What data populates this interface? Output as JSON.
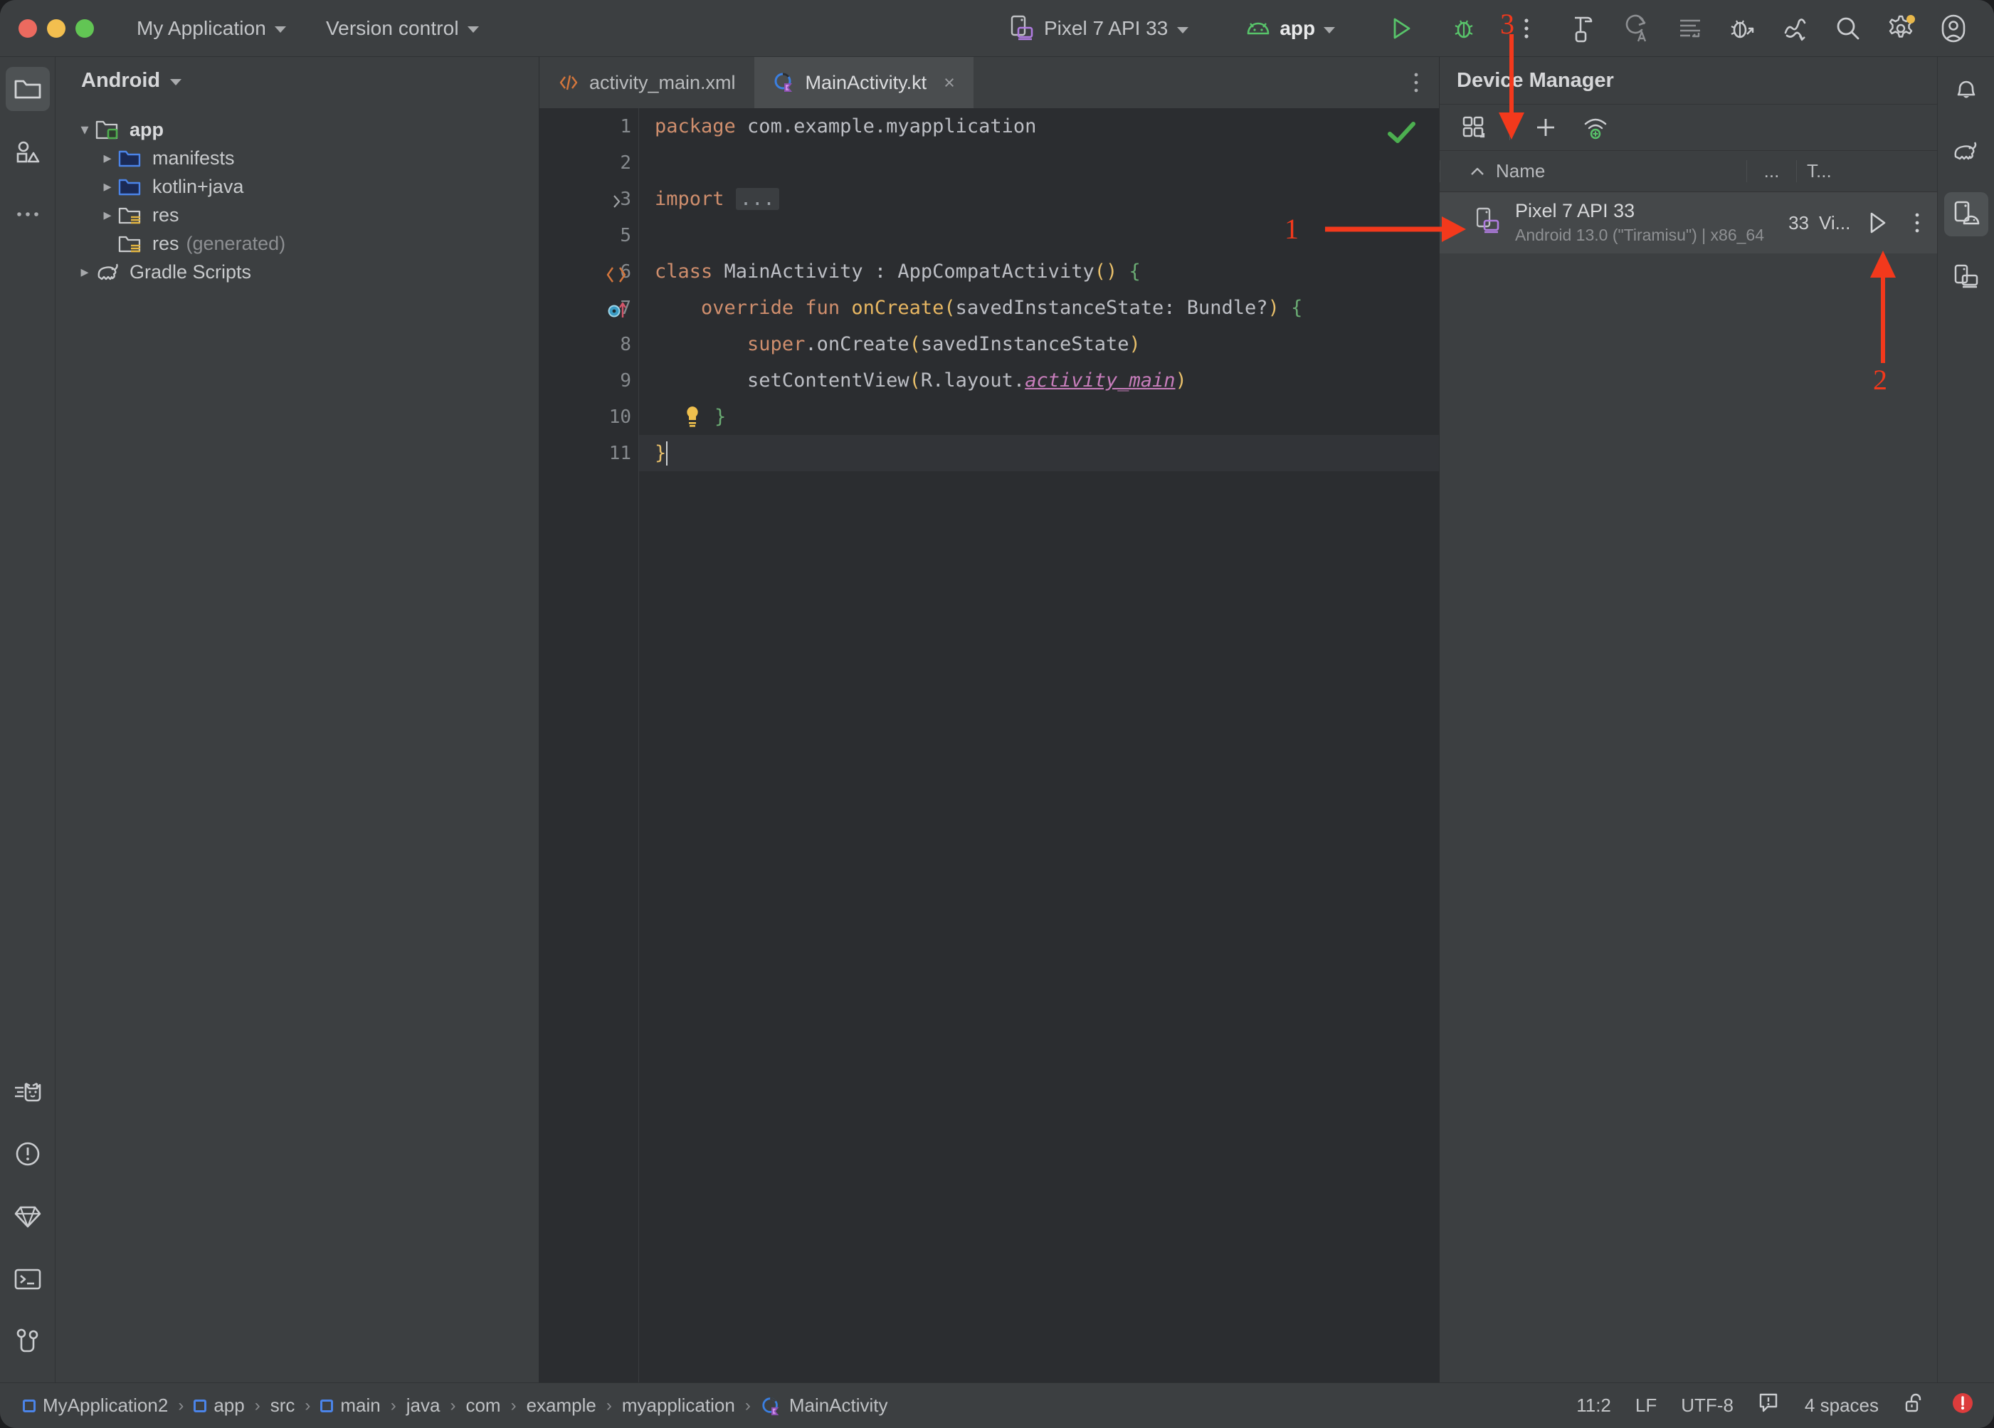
{
  "window": {
    "traffic": [
      "close",
      "minimize",
      "zoom"
    ]
  },
  "toolbar": {
    "project_name": "My Application",
    "vcs_label": "Version control",
    "device_selector": "Pixel 7 API 33",
    "run_config": "app",
    "icons": [
      "more-vertical-icon",
      "build-hammer-icon",
      "redo-a-icon",
      "code-format-icon",
      "debug-attach-icon",
      "profiler-icon",
      "search-icon",
      "settings-gear-icon",
      "account-icon"
    ]
  },
  "left_rail": {
    "items": [
      {
        "name": "project-tool-window",
        "icon": "folder-icon",
        "selected": true
      },
      {
        "name": "resource-manager",
        "icon": "shapes-icon",
        "selected": false
      },
      {
        "name": "more-tool-windows",
        "icon": "ellipsis-icon",
        "selected": false
      },
      {
        "name": "logcat",
        "icon": "cat-icon",
        "selected": false
      },
      {
        "name": "problems",
        "icon": "warning-circle-icon",
        "selected": false
      },
      {
        "name": "build",
        "icon": "diamond-icon",
        "selected": false
      },
      {
        "name": "terminal",
        "icon": "terminal-icon",
        "selected": false
      },
      {
        "name": "version-control",
        "icon": "git-branch-icon",
        "selected": false
      }
    ]
  },
  "project": {
    "title": "Android",
    "tree": [
      {
        "label": "app",
        "icon": "module-folder-icon",
        "expanded": true,
        "indent": 0,
        "bold": true,
        "dim": ""
      },
      {
        "label": "manifests",
        "icon": "blue-folder-icon",
        "expanded": false,
        "indent": 1,
        "bold": false,
        "dim": ""
      },
      {
        "label": "kotlin+java",
        "icon": "blue-folder-icon",
        "expanded": false,
        "indent": 1,
        "bold": false,
        "dim": ""
      },
      {
        "label": "res",
        "icon": "res-folder-icon",
        "expanded": false,
        "indent": 1,
        "bold": false,
        "dim": ""
      },
      {
        "label": "res",
        "icon": "res-folder-icon",
        "expanded": null,
        "indent": 1,
        "bold": false,
        "dim": "(generated)"
      },
      {
        "label": "Gradle Scripts",
        "icon": "gradle-elephant-icon",
        "expanded": false,
        "indent": 0,
        "bold": false,
        "dim": ""
      }
    ]
  },
  "editor": {
    "tabs": [
      {
        "label": "activity_main.xml",
        "icon": "xml-icon",
        "active": false,
        "closable": false
      },
      {
        "label": "MainActivity.kt",
        "icon": "kotlin-class-icon",
        "active": true,
        "closable": true,
        "close_label": "×"
      }
    ],
    "line_numbers": [
      "1",
      "2",
      "3",
      "5",
      "6",
      "7",
      "8",
      "9",
      "10",
      "11"
    ],
    "current_line": "11",
    "inspection_status": "ok-checkmark",
    "lines": [
      {
        "num": "1",
        "gutter": "",
        "text": "package com.example.myapplication"
      },
      {
        "num": "2",
        "gutter": "",
        "text": ""
      },
      {
        "num": "3",
        "gutter": "fold-arrow",
        "text": "import ..."
      },
      {
        "num": "5",
        "gutter": "",
        "text": ""
      },
      {
        "num": "6",
        "gutter": "xml-marker",
        "text": "class MainActivity : AppCompatActivity() {"
      },
      {
        "num": "7",
        "gutter": "override-marker",
        "text": "    override fun onCreate(savedInstanceState: Bundle?) {"
      },
      {
        "num": "8",
        "gutter": "",
        "text": "        super.onCreate(savedInstanceState)"
      },
      {
        "num": "9",
        "gutter": "",
        "text": "        setContentView(R.layout.activity_main)"
      },
      {
        "num": "10",
        "gutter": "",
        "text": "    }",
        "hint": "lightbulb-icon"
      },
      {
        "num": "11",
        "gutter": "",
        "text": "}"
      }
    ]
  },
  "device_manager": {
    "title": "Device Manager",
    "toolbar_icons": [
      "device-grid-icon",
      "add-device-icon",
      "pair-wifi-icon"
    ],
    "columns": [
      "Name",
      "...",
      "T...",
      ""
    ],
    "sort_indicator": "ascending",
    "rows": [
      {
        "name": "Pixel 7 API 33",
        "sub": "Android 13.0 (\"Tiramisu\")  |  x86_64",
        "api": "33",
        "type": "Vi...",
        "actions": [
          "launch-play-icon",
          "overflow-menu-icon"
        ],
        "selected": true
      }
    ]
  },
  "right_rail": {
    "items": [
      {
        "name": "notifications",
        "icon": "bell-icon",
        "selected": false
      },
      {
        "name": "gradle",
        "icon": "gradle-elephant-icon",
        "selected": false
      },
      {
        "name": "device-manager",
        "icon": "device-manager-icon",
        "selected": true
      },
      {
        "name": "running-devices",
        "icon": "running-devices-icon",
        "selected": false
      }
    ]
  },
  "status_bar": {
    "breadcrumbs": [
      {
        "label": "MyApplication2",
        "icon": "module-icon"
      },
      {
        "label": "app",
        "icon": "module-icon"
      },
      {
        "label": "src",
        "icon": ""
      },
      {
        "label": "main",
        "icon": "module-icon"
      },
      {
        "label": "java",
        "icon": ""
      },
      {
        "label": "com",
        "icon": ""
      },
      {
        "label": "example",
        "icon": ""
      },
      {
        "label": "myapplication",
        "icon": ""
      },
      {
        "label": "MainActivity",
        "icon": "kotlin-class-icon"
      }
    ],
    "separator": "›",
    "caret_position": "11:2",
    "line_separator": "LF",
    "encoding": "UTF-8",
    "indent": "4 spaces",
    "icons": [
      "inspection-balloon-icon",
      "unlock-icon",
      "error-badge-icon"
    ]
  },
  "annotations": {
    "accent_color": "#f3391c",
    "markers": [
      {
        "label": "1",
        "target": "device-manager-row",
        "direction": "right"
      },
      {
        "label": "2",
        "target": "device-launch-play-button",
        "direction": "up"
      },
      {
        "label": "3",
        "target": "device-manager-add-button",
        "direction": "down"
      }
    ]
  }
}
